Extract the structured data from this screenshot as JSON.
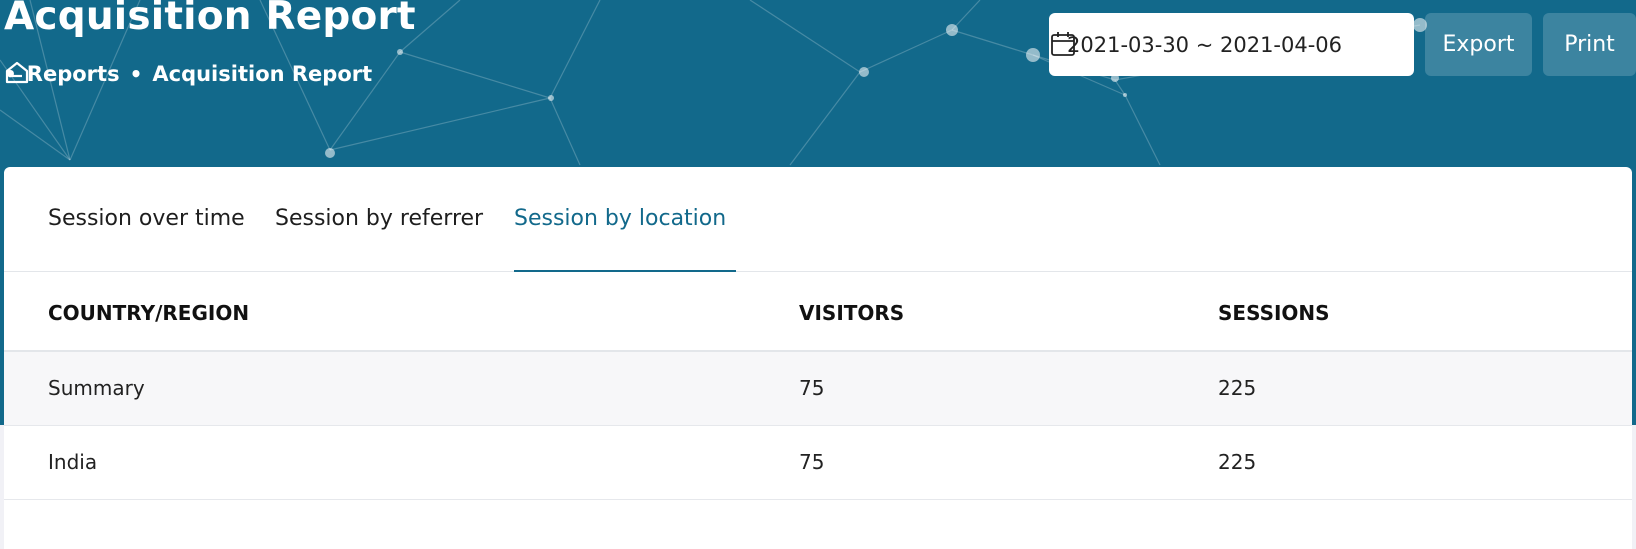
{
  "header": {
    "title": "Acquisition Report",
    "breadcrumb": [
      {
        "label": "Reports"
      },
      {
        "label": "Acquisition Report"
      }
    ],
    "breadcrumb_separator": "•",
    "home_icon": "home-icon",
    "date_range": "2021-03-30 ~ 2021-04-06",
    "calendar_icon": "calendar-icon",
    "export_label": "Export",
    "print_label": "Print"
  },
  "tabs": [
    {
      "label": "Session over time",
      "active": false
    },
    {
      "label": "Session by referrer",
      "active": false
    },
    {
      "label": "Session by location",
      "active": true
    }
  ],
  "table": {
    "columns": [
      "COUNTRY/REGION",
      "VISITORS",
      "SESSIONS"
    ],
    "rows": [
      {
        "region": "Summary",
        "visitors": "75",
        "sessions": "225"
      },
      {
        "region": "India",
        "visitors": "75",
        "sessions": "225"
      }
    ]
  },
  "colors": {
    "header_bg": "#12698b",
    "accent": "#12698b",
    "page_bg": "#f1f1f6"
  }
}
